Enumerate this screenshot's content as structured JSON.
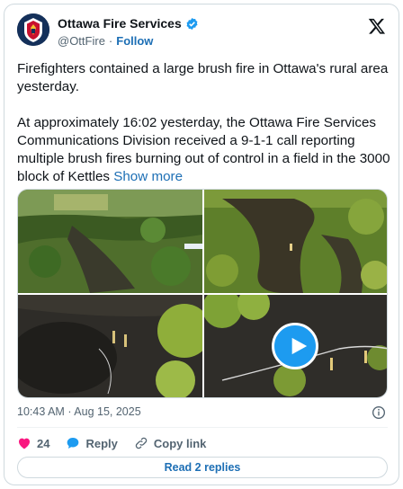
{
  "author": {
    "name": "Ottawa Fire Services",
    "handle": "@OttFire",
    "separator": "·",
    "follow_label": "Follow",
    "verified": true
  },
  "tweet": {
    "paragraph_1": "Firefighters contained a large brush fire in Ottawa's rural area yesterday.",
    "paragraph_2": "At approximately 16:02 yesterday, the Ottawa Fire Services Communications Division received a 9-1-1 call reporting multiple brush fires burning out of control in a field in the 3000 block of Kettles",
    "show_more": "Show more"
  },
  "media": {
    "items": [
      {
        "kind": "photo",
        "subject": "aerial view of burned field and forest"
      },
      {
        "kind": "photo",
        "subject": "aerial view of firefighters in burned green field"
      },
      {
        "kind": "photo",
        "subject": "drone view of charred ground with firefighters"
      },
      {
        "kind": "video",
        "subject": "firefighters with hose on blackened field"
      }
    ],
    "play_icon": "play-icon"
  },
  "meta": {
    "time": "10:43 AM",
    "separator": "·",
    "date": "Aug 15, 2025"
  },
  "actions": {
    "like_count": "24",
    "reply_label": "Reply",
    "copy_link_label": "Copy link"
  },
  "replies_button": "Read 2 replies",
  "colors": {
    "link": "#1d6fb5",
    "like": "#f91880",
    "verified": "#1d9bf0",
    "muted": "#536471"
  }
}
